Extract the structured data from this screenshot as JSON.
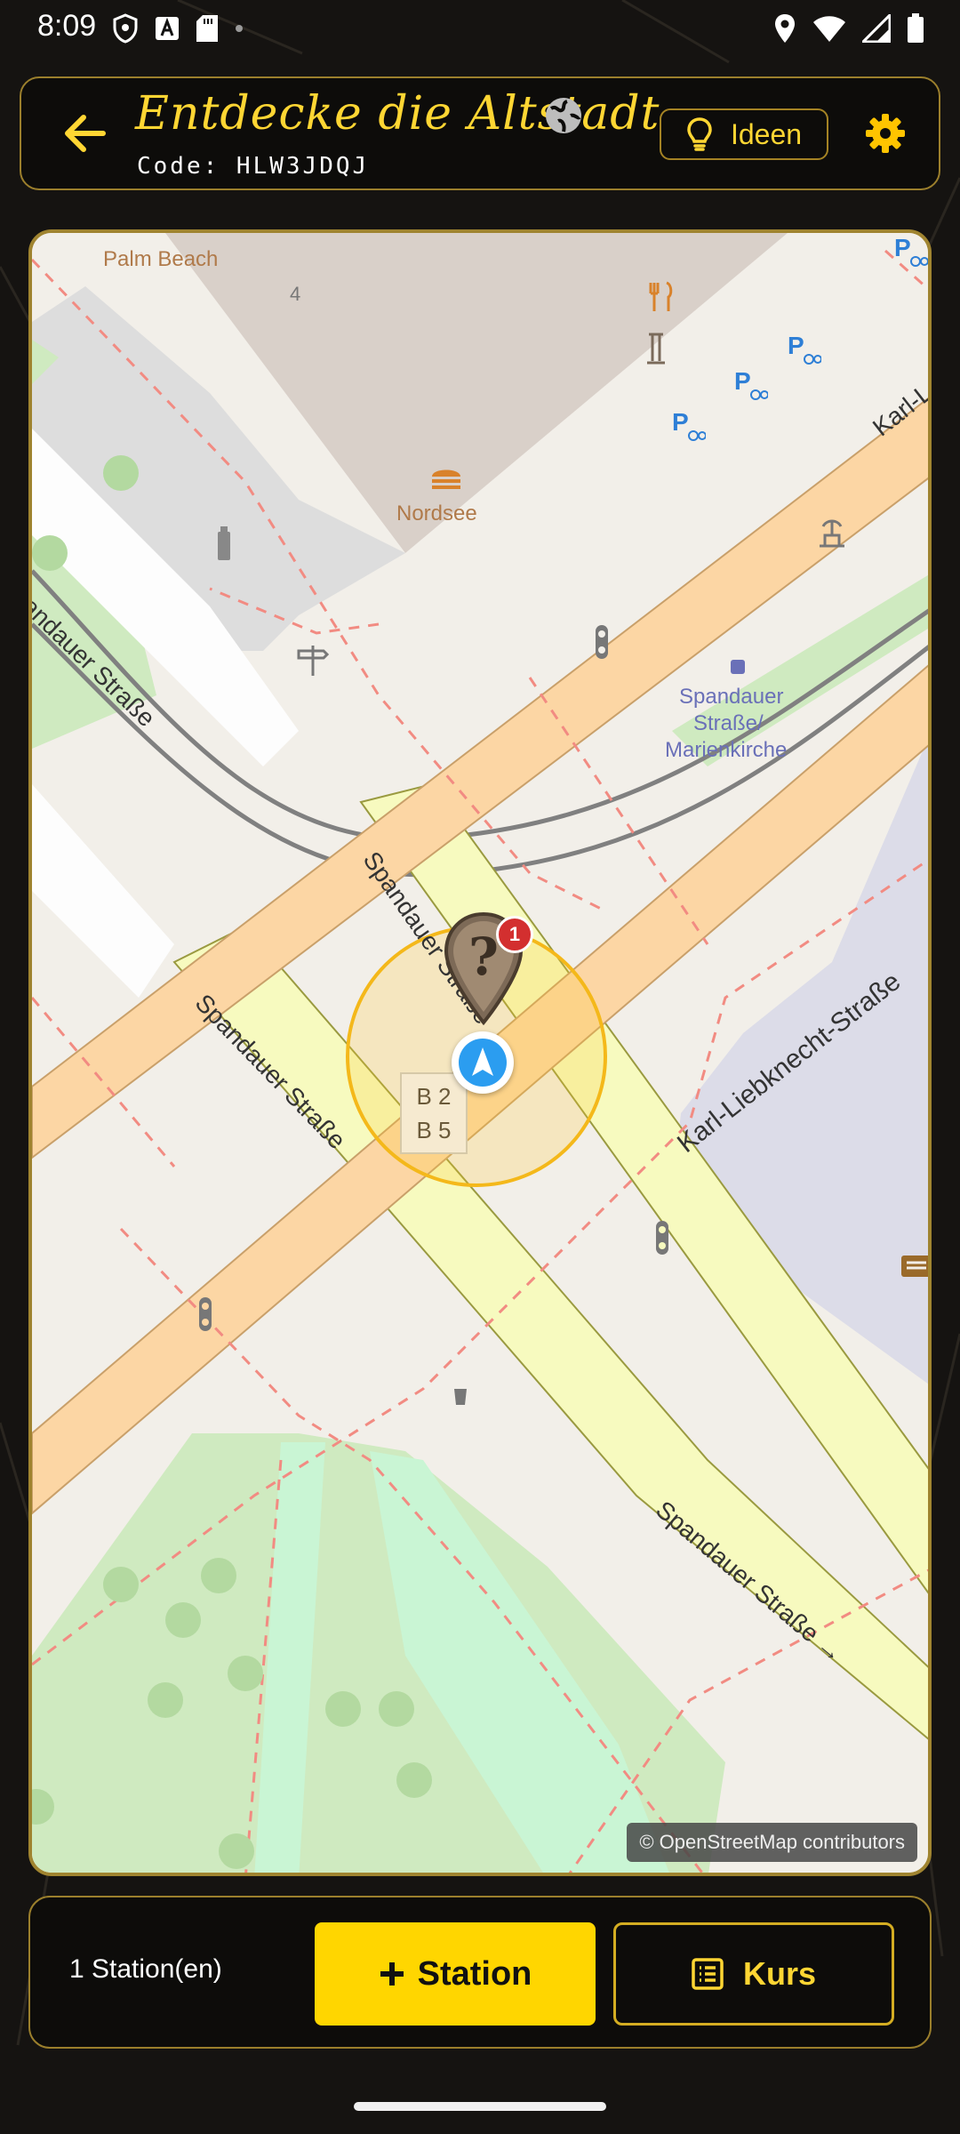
{
  "status_bar": {
    "time": "8:09"
  },
  "header": {
    "title": "Entdecke die Altstadt",
    "code_prefix": "Code: ",
    "code_value": "HLW3JDQJ",
    "ideas_label": "Ideen"
  },
  "map": {
    "attribution": "© OpenStreetMap contributors",
    "labels": {
      "palm_beach": "Palm Beach",
      "number_4": "4",
      "nordsee": "Nordsee",
      "spandauer_strasse_1": "Spandauer Straße",
      "spandauer_strasse_2": "Spandauer Straße",
      "spandauer_strasse_3": "Spandauer Straße",
      "spandauer_strasse_4": "Spandauer Straße →",
      "karl_liebknecht": "Karl-Liebknecht-Straße",
      "karl_partial": "Karl-L",
      "stop_line1": "Spandauer",
      "stop_line2": "Straße/",
      "stop_line3": "Marienkirche",
      "house_1": "B 2",
      "house_2": "B 5"
    },
    "marker_badge": "1"
  },
  "bottom_bar": {
    "station_count": "1 Station(en)",
    "add_station_label": "Station",
    "course_label": "Kurs"
  },
  "colors": {
    "accent": "#ffd633",
    "button_yellow": "#ffd600",
    "badge_red": "#d32f2f",
    "location_blue": "#2b9df0"
  }
}
